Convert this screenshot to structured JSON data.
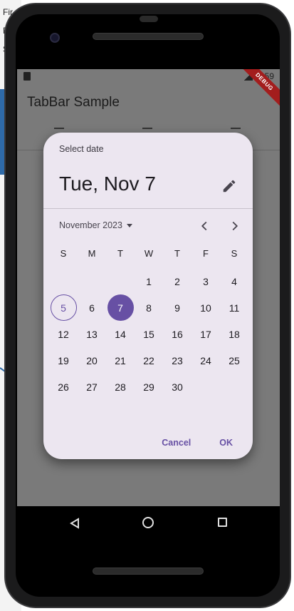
{
  "desktop": {
    "fragments": [
      "Fir",
      "F",
      "S"
    ]
  },
  "statusbar": {
    "time": "59",
    "debug_banner": "DEBUG"
  },
  "app": {
    "title": "TabBar Sample"
  },
  "date_picker": {
    "help_text": "Select date",
    "headline": "Tue, Nov 7",
    "month_label": "November 2023",
    "weekdays": [
      "S",
      "M",
      "T",
      "W",
      "T",
      "F",
      "S"
    ],
    "leading_blanks": 3,
    "days": [
      "1",
      "2",
      "3",
      "4",
      "5",
      "6",
      "7",
      "8",
      "9",
      "10",
      "11",
      "12",
      "13",
      "14",
      "15",
      "16",
      "17",
      "18",
      "19",
      "20",
      "21",
      "22",
      "23",
      "24",
      "25",
      "26",
      "27",
      "28",
      "29",
      "30"
    ],
    "today": "5",
    "selected": "7",
    "cancel_label": "Cancel",
    "ok_label": "OK",
    "accent_color": "#6750a4"
  },
  "icons": {
    "edit": "pencil-icon",
    "prev": "chevron-left-icon",
    "next": "chevron-right-icon",
    "dropdown": "caret-down-icon"
  }
}
